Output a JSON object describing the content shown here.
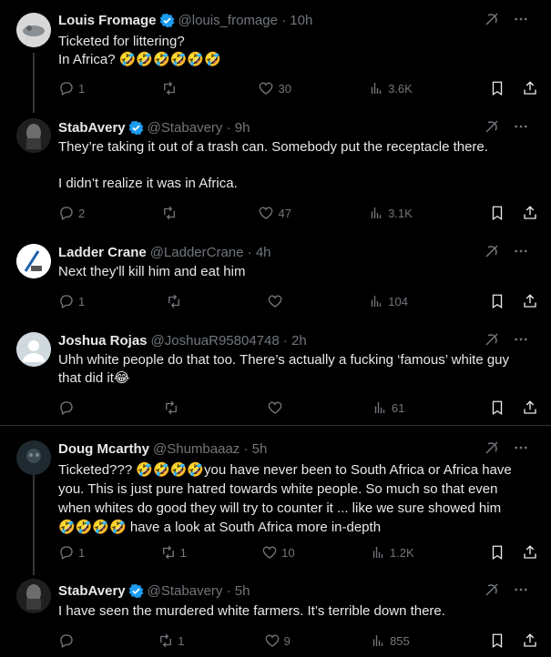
{
  "icons": {
    "verified_color": "#1d9bf0",
    "action_color": "#71767b"
  },
  "tweets": [
    {
      "name": "Louis Fromage",
      "handle": "@louis_fromage · 10h",
      "verified": true,
      "text": "Ticketed for littering?\nIn Africa? 🤣🤣🤣🤣🤣🤣",
      "replies": "1",
      "reposts": "",
      "likes": "30",
      "views": "3.6K"
    },
    {
      "name": "StabAvery",
      "handle": "@Stabavery · 9h",
      "verified": true,
      "text": "They’re taking it out of a trash can. Somebody put the receptacle there.\n\nI didn’t realize it was in Africa.",
      "replies": "2",
      "reposts": "",
      "likes": "47",
      "views": "3.1K"
    },
    {
      "name": "Ladder Crane",
      "handle": "@LadderCrane · 4h",
      "verified": false,
      "text": "Next they'll kill him and eat him",
      "replies": "1",
      "reposts": "",
      "likes": "",
      "views": "104"
    },
    {
      "name": "Joshua Rojas",
      "handle": "@JoshuaR95804748 · 2h",
      "verified": false,
      "text": "Uhh white people do that too. There’s actually a fucking ‘famous’ white guy\nthat did it😂",
      "replies": "",
      "reposts": "",
      "likes": "",
      "views": "61"
    },
    {
      "name": "Doug Mcarthy",
      "handle": "@Shumbaaaz · 5h",
      "verified": false,
      "text": "Ticketed??? 🤣🤣🤣🤣you have never been to South Africa or Africa have\nyou. This is just pure hatred towards white people. So much so that even\nwhen whites do good they will try to counter it ... like we sure showed him\n🤣🤣🤣🤣 have a look at South Africa more in-depth",
      "replies": "1",
      "reposts": "1",
      "likes": "10",
      "views": "1.2K"
    },
    {
      "name": "StabAvery",
      "handle": "@Stabavery · 5h",
      "verified": true,
      "text": "I have seen the murdered white farmers. It’s terrible down there.",
      "replies": "",
      "reposts": "1",
      "likes": "9",
      "views": "855"
    }
  ]
}
